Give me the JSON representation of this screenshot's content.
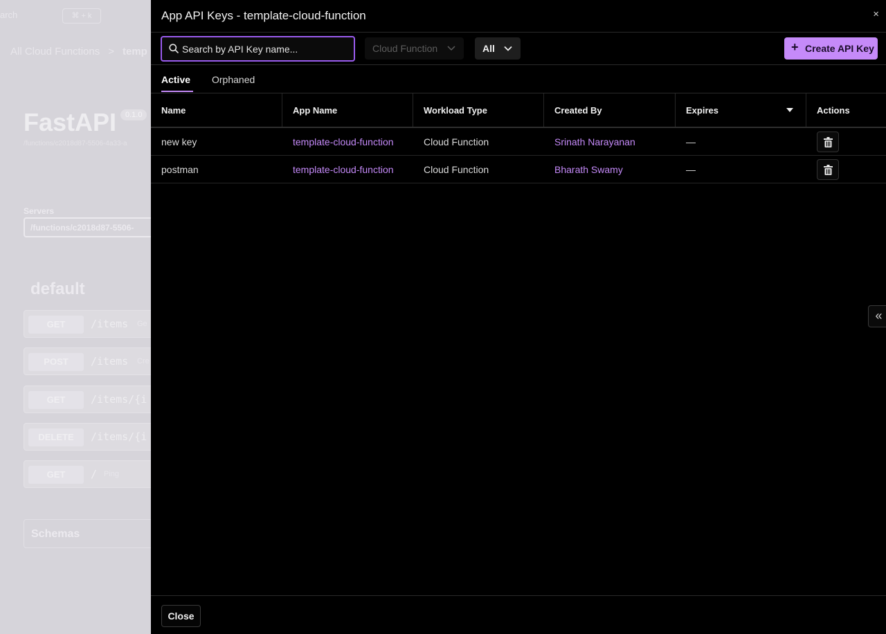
{
  "background": {
    "search_text": "arch",
    "search_shortcut": "⌘ + k",
    "breadcrumb": {
      "parent": "All Cloud Functions",
      "separator": ">",
      "current": "temp"
    },
    "api_title": "FastAPI",
    "api_version": "0.1.0",
    "api_path": "/functions/c2018d87-5506-4a33-a",
    "servers_label": "Servers",
    "servers_value": "/functions/c2018d87-5506-",
    "section_title": "default",
    "operations": [
      {
        "method": "GET",
        "path": "/items",
        "desc": "Ge"
      },
      {
        "method": "POST",
        "path": "/items",
        "desc": "Cre"
      },
      {
        "method": "GET",
        "path": "/items/{i",
        "desc": ""
      },
      {
        "method": "DELETE",
        "path": "/items/{i",
        "desc": ""
      },
      {
        "method": "GET",
        "path": "/",
        "desc": "Ping"
      }
    ],
    "schemas_label": "Schemas"
  },
  "drawer": {
    "title": "App API Keys - template-cloud-function",
    "close_icon": "×",
    "search": {
      "placeholder": "Search by API Key name...",
      "value": ""
    },
    "filter_type": {
      "value": "Cloud Function"
    },
    "filter_scope": {
      "value": "All"
    },
    "create_button": {
      "icon": "+",
      "label": "Create API Key"
    },
    "tabs": [
      {
        "label": "Active",
        "active": true
      },
      {
        "label": "Orphaned",
        "active": false
      }
    ],
    "table": {
      "columns": [
        "Name",
        "App Name",
        "Workload Type",
        "Created By",
        "Expires",
        "Actions"
      ],
      "rows": [
        {
          "name": "new key",
          "app_name": "template-cloud-function",
          "workload_type": "Cloud Function",
          "created_by": "Srinath Narayanan",
          "expires": "—"
        },
        {
          "name": "postman",
          "app_name": "template-cloud-function",
          "workload_type": "Cloud Function",
          "created_by": "Bharath Swamy",
          "expires": "—"
        }
      ]
    },
    "footer_close": "Close",
    "collapse_icon": "«"
  },
  "colors": {
    "accent": "#c58af9",
    "focus_border": "#9b5cf0",
    "drawer_bg": "#000000"
  }
}
